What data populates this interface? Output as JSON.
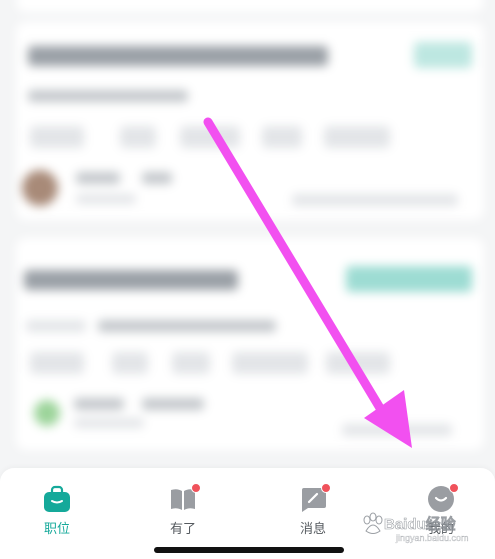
{
  "tabbar": {
    "tabs": [
      {
        "label": "职位",
        "icon": "briefcase-icon",
        "active": true,
        "badge": false
      },
      {
        "label": "有了",
        "icon": "book-icon",
        "active": false,
        "badge": true
      },
      {
        "label": "消息",
        "icon": "chat-icon",
        "active": false,
        "badge": true
      },
      {
        "label": "我的",
        "icon": "profile-icon",
        "active": false,
        "badge": true
      }
    ]
  },
  "watermark": {
    "text": "Baidu经验",
    "url": "jingyan.baidu.com"
  },
  "colors": {
    "accent": "#15a99a",
    "badge": "#f0525b",
    "annotation_arrow": "#f250f0",
    "inactive_icon": "#9a9da2"
  }
}
